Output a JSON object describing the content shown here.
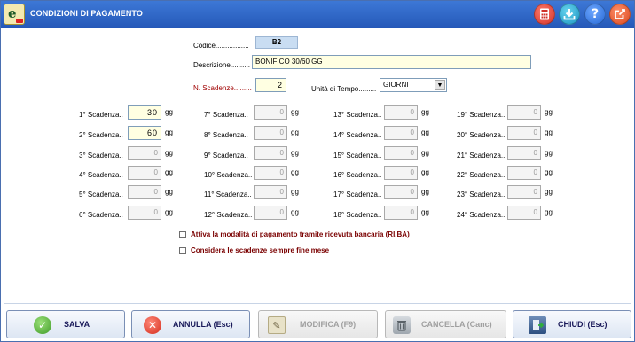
{
  "window": {
    "title": "CONDIZIONI DI PAGAMENTO"
  },
  "titlebar": {
    "help_glyph": "?",
    "icons": [
      "calculator-icon",
      "download-icon",
      "help-icon",
      "exit-icon"
    ]
  },
  "form": {
    "codice_label": "Codice.................",
    "codice_value": "B2",
    "descrizione_label": "Descrizione..........",
    "descrizione_value": "BONIFICO 30/60 GG",
    "n_scadenze_label": "N. Scadenze.........",
    "n_scadenze_value": "2",
    "unita_label": "Unità di Tempo.........",
    "unita_value": "GIORNI",
    "unit_suffix": "gg"
  },
  "scadenze": [
    {
      "label": "1° Scadenza..",
      "value": "30",
      "enabled": true
    },
    {
      "label": "2° Scadenza..",
      "value": "60",
      "enabled": true
    },
    {
      "label": "3° Scadenza..",
      "value": "0",
      "enabled": false
    },
    {
      "label": "4° Scadenza..",
      "value": "0",
      "enabled": false
    },
    {
      "label": "5° Scadenza..",
      "value": "0",
      "enabled": false
    },
    {
      "label": "6° Scadenza..",
      "value": "0",
      "enabled": false
    },
    {
      "label": "7° Scadenza..",
      "value": "0",
      "enabled": false
    },
    {
      "label": "8° Scadenza..",
      "value": "0",
      "enabled": false
    },
    {
      "label": "9° Scadenza..",
      "value": "0",
      "enabled": false
    },
    {
      "label": "10° Scadenza..",
      "value": "0",
      "enabled": false
    },
    {
      "label": "11° Scadenza..",
      "value": "0",
      "enabled": false
    },
    {
      "label": "12° Scadenza..",
      "value": "0",
      "enabled": false
    },
    {
      "label": "13° Scadenza..",
      "value": "0",
      "enabled": false
    },
    {
      "label": "14° Scadenza..",
      "value": "0",
      "enabled": false
    },
    {
      "label": "15° Scadenza..",
      "value": "0",
      "enabled": false
    },
    {
      "label": "16° Scadenza..",
      "value": "0",
      "enabled": false
    },
    {
      "label": "17° Scadenza..",
      "value": "0",
      "enabled": false
    },
    {
      "label": "18° Scadenza..",
      "value": "0",
      "enabled": false
    },
    {
      "label": "19° Scadenza..",
      "value": "0",
      "enabled": false
    },
    {
      "label": "20° Scadenza..",
      "value": "0",
      "enabled": false
    },
    {
      "label": "21° Scadenza..",
      "value": "0",
      "enabled": false
    },
    {
      "label": "22° Scadenza..",
      "value": "0",
      "enabled": false
    },
    {
      "label": "23° Scadenza..",
      "value": "0",
      "enabled": false
    },
    {
      "label": "24° Scadenza..",
      "value": "0",
      "enabled": false
    }
  ],
  "options": {
    "riba_label": "Attiva la modalità di pagamento tramite ricevuta bancaria (RI.BA)",
    "riba_checked": false,
    "fine_mese_label": "Considera le scadenze sempre fine mese",
    "fine_mese_checked": false
  },
  "buttons": {
    "salva": "SALVA",
    "annulla": "ANNULLA (Esc)",
    "modifica": "MODIFICA  (F9)",
    "cancella": "CANCELLA  (Canc)",
    "chiudi": "CHIUDI  (Esc)"
  },
  "colors": {
    "titlebar": "#2558b8",
    "required_label": "#a00000",
    "checkbox_label": "#7a0000"
  }
}
